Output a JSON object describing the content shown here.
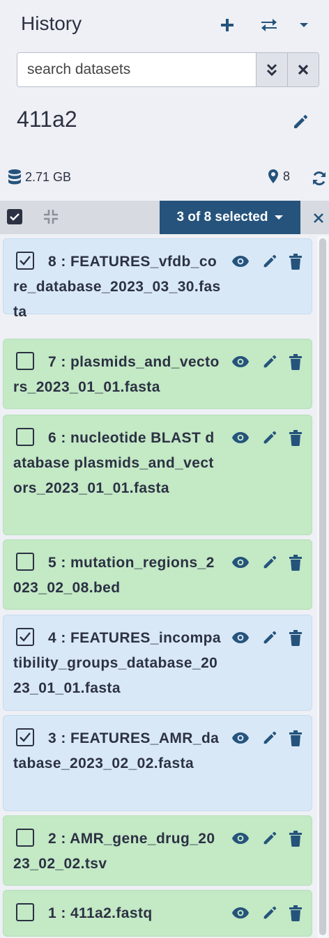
{
  "header": {
    "title": "History",
    "new_icon": "plus-icon",
    "switch_icon": "exchange-icon",
    "options_icon": "caret-down-icon"
  },
  "search": {
    "placeholder": "search datasets",
    "value": "",
    "advanced_icon": "double-chevron-down-icon",
    "clear_icon": "times-icon"
  },
  "history": {
    "name": "411a2",
    "size": "2.71 GB",
    "count": "8",
    "size_icon": "database-icon",
    "count_icon": "map-marker-icon",
    "refresh_icon": "sync-icon"
  },
  "selection": {
    "label": "3 of 8 selected",
    "selected_count": 3,
    "total_count": 8
  },
  "colors": {
    "ok_bg": "#c3e9c5",
    "selected_bg": "#d8e8f7",
    "accent": "#25537b",
    "text": "#2c3143"
  },
  "items": [
    {
      "hid": 8,
      "text": "8 : FEATURES_vfdb_core_database_2023_03_30.fasta",
      "checked": true,
      "state": "selected"
    },
    {
      "hid": 7,
      "text": "7 : plasmids_and_vectors_2023_01_01.fasta",
      "checked": false,
      "state": "ok"
    },
    {
      "hid": 6,
      "text": "6 : nucleotide BLAST database plasmids_and_vectors_2023_01_01.fasta",
      "checked": false,
      "state": "ok"
    },
    {
      "hid": 5,
      "text": "5 : mutation_regions_2023_02_08.bed",
      "checked": false,
      "state": "ok"
    },
    {
      "hid": 4,
      "text": "4 : FEATURES_incompatibility_groups_database_2023_01_01.fasta",
      "checked": true,
      "state": "selected"
    },
    {
      "hid": 3,
      "text": "3 : FEATURES_AMR_database_2023_02_02.fasta",
      "checked": true,
      "state": "selected"
    },
    {
      "hid": 2,
      "text": "2 : AMR_gene_drug_2023_02_02.tsv",
      "checked": false,
      "state": "ok"
    },
    {
      "hid": 1,
      "text": "1 : 411a2.fastq",
      "checked": false,
      "state": "ok"
    }
  ]
}
